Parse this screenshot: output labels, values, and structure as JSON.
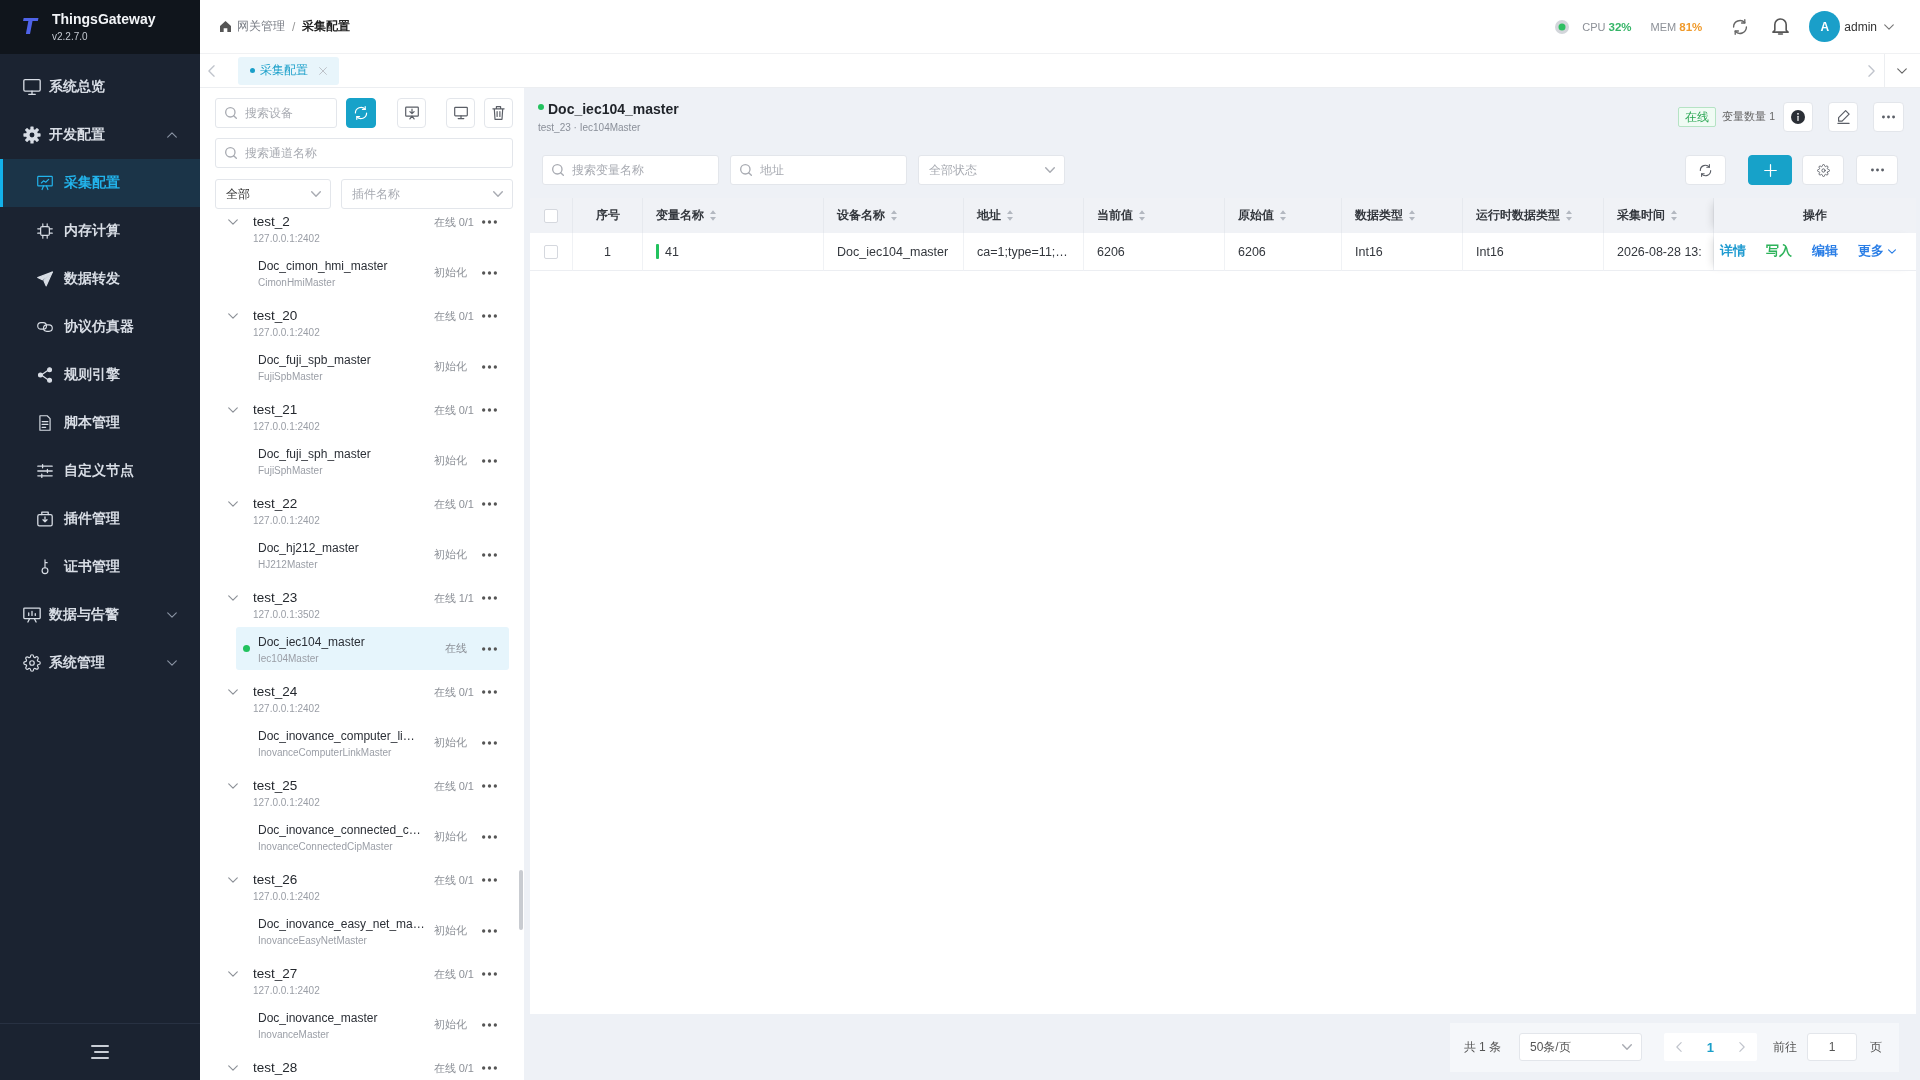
{
  "sidebar": {
    "logo": {
      "mark": "T",
      "title": "ThingsGateway",
      "version": "v2.2.7.0"
    },
    "menu": [
      {
        "label": "系统总览",
        "selected": false
      },
      {
        "label": "开发配置",
        "selected": false,
        "expanded": true,
        "children": [
          {
            "label": "采集配置",
            "selected": true
          },
          {
            "label": "内存计算",
            "selected": false
          },
          {
            "label": "数据转发",
            "selected": false
          },
          {
            "label": "协议仿真器",
            "selected": false
          },
          {
            "label": "规则引擎",
            "selected": false
          },
          {
            "label": "脚本管理",
            "selected": false
          },
          {
            "label": "自定义节点",
            "selected": false
          },
          {
            "label": "插件管理",
            "selected": false
          },
          {
            "label": "证书管理",
            "selected": false
          }
        ]
      },
      {
        "label": "数据与告警",
        "selected": false,
        "expanded": false
      },
      {
        "label": "系统管理",
        "selected": false,
        "expanded": false
      }
    ]
  },
  "header": {
    "breadcrumb": [
      {
        "label": "网关管理",
        "current": false
      },
      {
        "label": "采集配置",
        "current": true
      }
    ],
    "separator": "/",
    "server": {
      "online": true
    },
    "metrics": [
      {
        "label": "CPU",
        "value": "32%",
        "color": "#35b567"
      },
      {
        "label": "MEM",
        "value": "81%",
        "color": "#f09a2b"
      }
    ],
    "user": {
      "initial": "A",
      "name": "admin"
    }
  },
  "tabs": [
    {
      "label": "采集配置",
      "selected": true
    }
  ],
  "device_panel": {
    "device_search": {
      "placeholder": "搜索设备"
    },
    "channel_search": {
      "placeholder": "搜索通道名称"
    },
    "type_filter": {
      "value": "全部"
    },
    "plugin_filter": {
      "placeholder": "插件名称"
    },
    "channels": [
      {
        "name": "test_2",
        "address": "127.0.0.1:2402",
        "status": "在线 0/1",
        "expanded": true,
        "children": [
          {
            "name": "Doc_cimon_hmi_master",
            "plugin": "CimonHmiMaster",
            "status": "初始化",
            "online": false,
            "selected": false
          }
        ]
      },
      {
        "name": "test_20",
        "address": "127.0.0.1:2402",
        "status": "在线 0/1",
        "expanded": true,
        "children": [
          {
            "name": "Doc_fuji_spb_master",
            "plugin": "FujiSpbMaster",
            "status": "初始化",
            "online": false,
            "selected": false
          }
        ]
      },
      {
        "name": "test_21",
        "address": "127.0.0.1:2402",
        "status": "在线 0/1",
        "expanded": true,
        "children": [
          {
            "name": "Doc_fuji_sph_master",
            "plugin": "FujiSphMaster",
            "status": "初始化",
            "online": false,
            "selected": false
          }
        ]
      },
      {
        "name": "test_22",
        "address": "127.0.0.1:2402",
        "status": "在线 0/1",
        "expanded": true,
        "children": [
          {
            "name": "Doc_hj212_master",
            "plugin": "HJ212Master",
            "status": "初始化",
            "online": false,
            "selected": false
          }
        ]
      },
      {
        "name": "test_23",
        "address": "127.0.0.1:3502",
        "status": "在线 1/1",
        "expanded": true,
        "children": [
          {
            "name": "Doc_iec104_master",
            "plugin": "Iec104Master",
            "status": "在线",
            "online": true,
            "selected": true
          }
        ]
      },
      {
        "name": "test_24",
        "address": "127.0.0.1:2402",
        "status": "在线 0/1",
        "expanded": true,
        "children": [
          {
            "name": "Doc_inovance_computer_li…",
            "plugin": "InovanceComputerLinkMaster",
            "status": "初始化",
            "online": false,
            "selected": false
          }
        ]
      },
      {
        "name": "test_25",
        "address": "127.0.0.1:2402",
        "status": "在线 0/1",
        "expanded": true,
        "children": [
          {
            "name": "Doc_inovance_connected_c…",
            "plugin": "InovanceConnectedCipMaster",
            "status": "初始化",
            "online": false,
            "selected": false
          }
        ]
      },
      {
        "name": "test_26",
        "address": "127.0.0.1:2402",
        "status": "在线 0/1",
        "expanded": true,
        "children": [
          {
            "name": "Doc_inovance_easy_net_ma…",
            "plugin": "InovanceEasyNetMaster",
            "status": "初始化",
            "online": false,
            "selected": false
          }
        ]
      },
      {
        "name": "test_27",
        "address": "127.0.0.1:2402",
        "status": "在线 0/1",
        "expanded": true,
        "children": [
          {
            "name": "Doc_inovance_master",
            "plugin": "InovanceMaster",
            "status": "初始化",
            "online": false,
            "selected": false
          }
        ]
      },
      {
        "name": "test_28",
        "status": "在线 0/1",
        "expanded": true
      }
    ]
  },
  "detail": {
    "title": "Doc_iec104_master",
    "online": true,
    "subtitle": "test_23 · Iec104Master",
    "status": "在线",
    "variable_count": "变量数量 1",
    "filters": [
      {
        "kind": "search",
        "placeholder": "搜索变量名称"
      },
      {
        "kind": "search",
        "placeholder": "地址"
      },
      {
        "kind": "select",
        "placeholder": "全部状态"
      }
    ],
    "table": {
      "all_checked": false,
      "columns": [
        {
          "label": "序号",
          "sortable": false
        },
        {
          "label": "变量名称",
          "sortable": true
        },
        {
          "label": "设备名称",
          "sortable": true
        },
        {
          "label": "地址",
          "sortable": true
        },
        {
          "label": "当前值",
          "sortable": true
        },
        {
          "label": "原始值",
          "sortable": true
        },
        {
          "label": "数据类型",
          "sortable": true
        },
        {
          "label": "运行时数据类型",
          "sortable": true
        },
        {
          "label": "采集时间",
          "sortable": true
        },
        {
          "label": "操作",
          "sortable": false
        }
      ],
      "rows": [
        {
          "checked": false,
          "online": true,
          "index": "1",
          "name": "41",
          "device": "Doc_iec104_master",
          "address": "ca=1;type=11;…",
          "current_value": "6206",
          "raw_value": "6206",
          "data_type": "Int16",
          "runtime_type": "Int16",
          "collect_time": "2026-08-28 13:",
          "actions": [
            {
              "label": "详情",
              "kind": "link",
              "color": "#1e9ad0"
            },
            {
              "label": "写入",
              "kind": "link",
              "color": "#2eb35b"
            },
            {
              "label": "编辑",
              "kind": "link",
              "color": "#2a7ee6"
            },
            {
              "label": "更多",
              "kind": "dropdown",
              "color": "#2a7ee6"
            }
          ]
        }
      ]
    }
  },
  "pagination": {
    "total": "共 1 条",
    "page_size": "50条/页",
    "pages": [
      {
        "label": "1",
        "selected": true
      }
    ],
    "goto_label": "前往",
    "goto_value": "1",
    "page_suffix": "页"
  }
}
